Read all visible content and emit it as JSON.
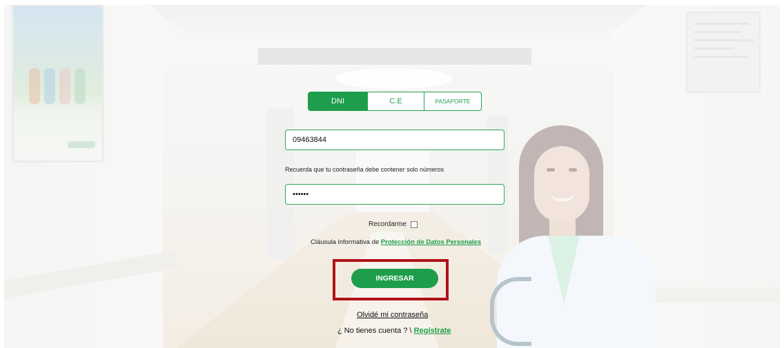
{
  "tabs": [
    {
      "label": "DNI",
      "active": true
    },
    {
      "label": "C.E",
      "active": false
    },
    {
      "label": "PASAPORTE",
      "active": false
    }
  ],
  "login": {
    "document_value": "09463844",
    "password_hint": "Recuerda que tu contraseña debe contener solo números",
    "password_value": "••••••",
    "remember_label": "Recordarme",
    "remember_checked": false,
    "clause_text": "Cláusula informativa de ",
    "clause_link": "Protección de Datos Personales",
    "submit_label": "INGRESAR",
    "forgot_label": "Olvidé mi contraseña",
    "no_account_text": "¿ No tienes cuenta ? \\ ",
    "register_label": "Regístrate"
  },
  "colors": {
    "accent": "#1e9e4c",
    "highlight_border": "#b01218"
  }
}
